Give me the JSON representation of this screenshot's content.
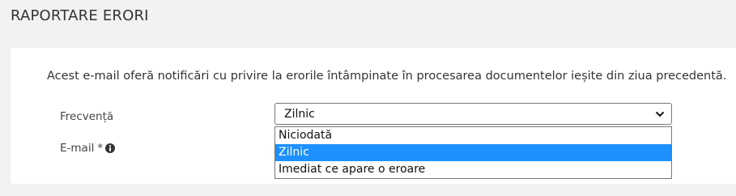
{
  "page": {
    "title": "RAPORTARE ERORI"
  },
  "card": {
    "description": "Acest e-mail oferă notificări cu privire la erorile întâmpinate în procesarea documentelor ieșite din ziua precedentă."
  },
  "form": {
    "frequency": {
      "label": "Frecvență",
      "selected_value": "Zilnic",
      "options": [
        "Niciodată",
        "Zilnic",
        "Imediat ce apare o eroare"
      ],
      "highlighted_index": 1
    },
    "email": {
      "label": "E-mail",
      "required_mark": "*",
      "info_icon": "info-circle-icon"
    }
  },
  "colors": {
    "background": "#f2f2f2",
    "card": "#ffffff",
    "highlight": "#1e90ff",
    "border": "#767676"
  }
}
